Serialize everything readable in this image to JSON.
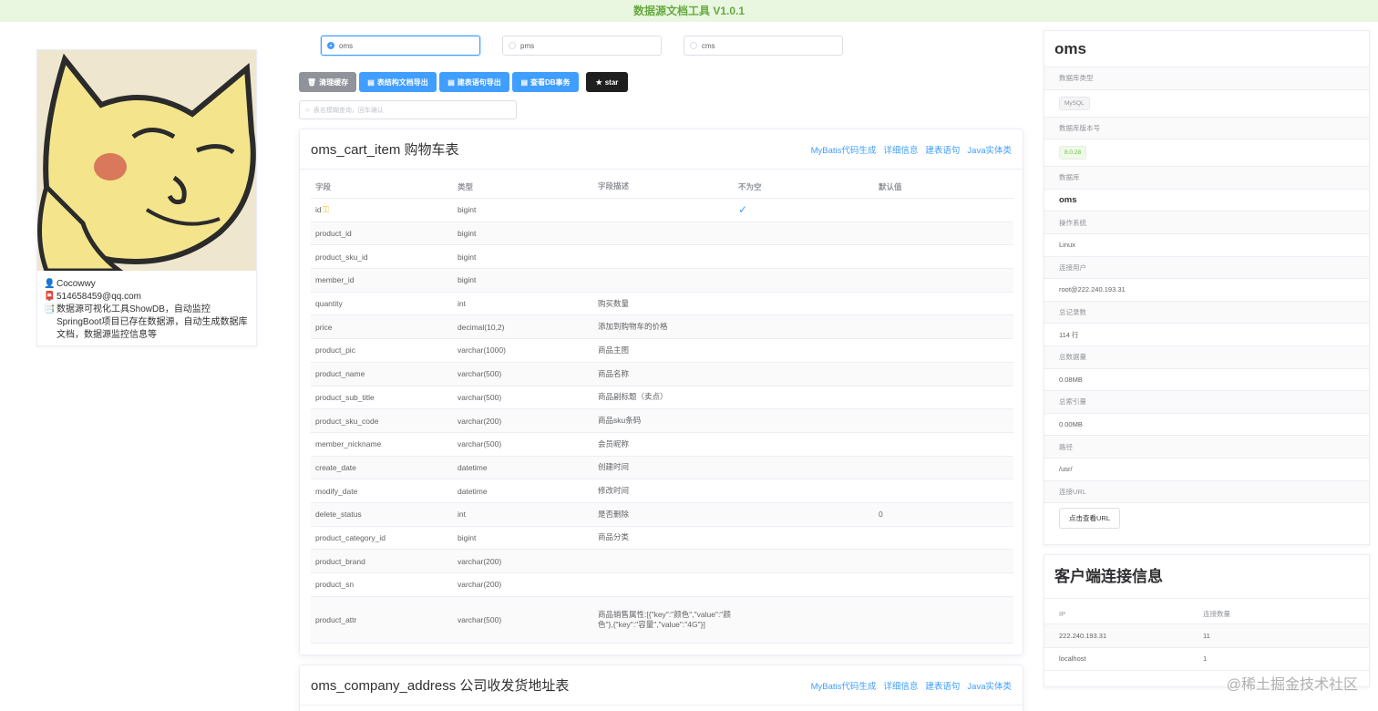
{
  "app": {
    "title": "数据源文档工具 V1.0.1"
  },
  "profile": {
    "name_icon": "user-icon",
    "name": "Cocowwy",
    "email_icon": "mailbox-icon",
    "email": "514658459@qq.com",
    "desc_icon": "memo-icon",
    "description": "数据源可视化工具ShowDB，自动监控SpringBoot项目已存在数据源，自动生成数据库文档，数据源监控信息等"
  },
  "datasources": [
    {
      "label": "oms",
      "selected": true
    },
    {
      "label": "pms",
      "selected": false
    },
    {
      "label": "cms",
      "selected": false
    }
  ],
  "toolbar": {
    "clear_cache": "清理缓存",
    "export_doc": "表结构文档导出",
    "export_ddl": "建表语句导出",
    "view_tx": "查看DB事务",
    "star": "star"
  },
  "search": {
    "placeholder": "表名模糊查询，回车确认"
  },
  "table_actions": {
    "mybatis": "MyBatis代码生成",
    "detail": "详细信息",
    "ddl": "建表语句",
    "java": "Java实体类"
  },
  "table1": {
    "title": "oms_cart_item 购物车表",
    "columns": [
      "字段",
      "类型",
      "字段描述",
      "不为空",
      "默认值"
    ],
    "rows": [
      {
        "field": "id",
        "type": "bigint",
        "desc": "",
        "notnull": "✓",
        "default": ""
      },
      {
        "field": "product_id",
        "type": "bigint",
        "desc": "",
        "notnull": "",
        "default": ""
      },
      {
        "field": "product_sku_id",
        "type": "bigint",
        "desc": "",
        "notnull": "",
        "default": ""
      },
      {
        "field": "member_id",
        "type": "bigint",
        "desc": "",
        "notnull": "",
        "default": ""
      },
      {
        "field": "quantity",
        "type": "int",
        "desc": "购买数量",
        "notnull": "",
        "default": ""
      },
      {
        "field": "price",
        "type": "decimal(10,2)",
        "desc": "添加到购物车的价格",
        "notnull": "",
        "default": ""
      },
      {
        "field": "product_pic",
        "type": "varchar(1000)",
        "desc": "商品主图",
        "notnull": "",
        "default": ""
      },
      {
        "field": "product_name",
        "type": "varchar(500)",
        "desc": "商品名称",
        "notnull": "",
        "default": ""
      },
      {
        "field": "product_sub_title",
        "type": "varchar(500)",
        "desc": "商品副标题（卖点）",
        "notnull": "",
        "default": ""
      },
      {
        "field": "product_sku_code",
        "type": "varchar(200)",
        "desc": "商品sku条码",
        "notnull": "",
        "default": ""
      },
      {
        "field": "member_nickname",
        "type": "varchar(500)",
        "desc": "会员昵称",
        "notnull": "",
        "default": ""
      },
      {
        "field": "create_date",
        "type": "datetime",
        "desc": "创建时间",
        "notnull": "",
        "default": ""
      },
      {
        "field": "modify_date",
        "type": "datetime",
        "desc": "修改时间",
        "notnull": "",
        "default": ""
      },
      {
        "field": "delete_status",
        "type": "int",
        "desc": "是否删除",
        "notnull": "",
        "default": "0"
      },
      {
        "field": "product_category_id",
        "type": "bigint",
        "desc": "商品分类",
        "notnull": "",
        "default": ""
      },
      {
        "field": "product_brand",
        "type": "varchar(200)",
        "desc": "",
        "notnull": "",
        "default": ""
      },
      {
        "field": "product_sn",
        "type": "varchar(200)",
        "desc": "",
        "notnull": "",
        "default": ""
      },
      {
        "field": "product_attr",
        "type": "varchar(500)",
        "desc": "商品销售属性:[{\"key\":\"颜色\",\"value\":\"颜色\"},{\"key\":\"容量\",\"value\":\"4G\"}]",
        "notnull": "",
        "default": ""
      }
    ]
  },
  "table2": {
    "title": "oms_company_address 公司收发货地址表"
  },
  "db_info": {
    "title": "oms",
    "type_label": "数据库类型",
    "type_value": "MySQL",
    "version_label": "数据库版本号",
    "version_value": "8.0.28",
    "db_label": "数据库",
    "db_value": "oms",
    "os_label": "操作系统",
    "os_value": "Linux",
    "user_label": "连接用户",
    "user_value": "root@222.240.193.31",
    "records_label": "总记录数",
    "records_value": "114 行",
    "data_size_label": "总数据量",
    "data_size_value": "0.08MB",
    "index_size_label": "总索引量",
    "index_size_value": "0.00MB",
    "path_label": "路径",
    "path_value": "/usr/",
    "url_label": "连接URL",
    "url_button": "点击查看URL"
  },
  "clients": {
    "title": "客户端连接信息",
    "columns": [
      "IP",
      "连接数量"
    ],
    "rows": [
      {
        "ip": "222.240.193.31",
        "count": "11"
      },
      {
        "ip": "localhost",
        "count": "1"
      }
    ]
  },
  "watermark": "@稀土掘金技术社区",
  "colors": {
    "primary": "#409eff",
    "success": "#67c23a",
    "header_bg": "#e9f7e1",
    "header_text": "#67a93f"
  }
}
